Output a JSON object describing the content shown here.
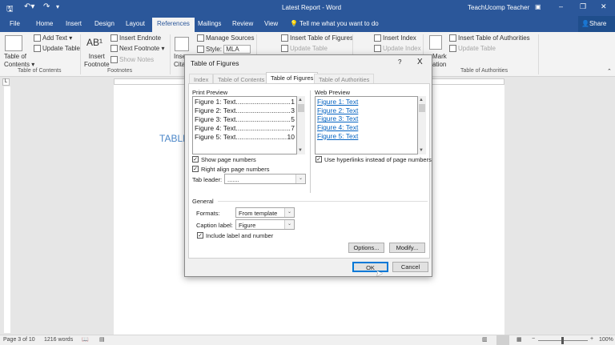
{
  "window": {
    "title": "Latest Report - Word",
    "user": "TeachUcomp Teacher"
  },
  "qat": {
    "save": "save-icon",
    "undo": "undo-icon",
    "redo": "redo-icon"
  },
  "tabs": [
    "File",
    "Home",
    "Insert",
    "Design",
    "Layout",
    "References",
    "Mailings",
    "Review",
    "View"
  ],
  "active_tab": "References",
  "tell_me": "Tell me what you want to do",
  "share": "Share",
  "ribbon": {
    "toc": {
      "btn1": "Table of",
      "btn2": "Contents",
      "add_text": "Add Text",
      "update_table": "Update Table",
      "group": "Table of Contents"
    },
    "footnotes": {
      "insert1": "Insert",
      "insert2": "Footnote",
      "insert_endnote": "Insert Endnote",
      "next_footnote": "Next Footnote",
      "show_notes": "Show Notes",
      "group": "Footnotes"
    },
    "citations": {
      "insert": "Inse",
      "citation": "Citati",
      "manage_sources": "Manage Sources",
      "style_label": "Style:",
      "style_value": "MLA"
    },
    "captions": {
      "insert_tof": "Insert Table of Figures",
      "update_table": "Update Table"
    },
    "index": {
      "insert_index": "Insert Index",
      "update_index": "Update Index"
    },
    "authorities": {
      "mark1": "Mark",
      "mark2": "ation",
      "insert_toa": "Insert Table of Authorities",
      "update_table": "Update Table",
      "group": "Table of Authorities"
    }
  },
  "document": {
    "heading": "TABLE"
  },
  "status": {
    "page": "Page 3 of 10",
    "words": "1216 words",
    "zoom": "100%",
    "zoom_level_percent": 100
  },
  "dialog": {
    "title": "Table of Figures",
    "help": "?",
    "close": "X",
    "tabs": [
      "Index",
      "Table of Contents",
      "Table of Figures",
      "Table of Authorities"
    ],
    "active_tab": "Table of Figures",
    "print_preview": {
      "label": "Print Preview",
      "entries": [
        {
          "text": "Figure 1: Text",
          "page": "1"
        },
        {
          "text": "Figure 2: Text",
          "page": "3"
        },
        {
          "text": "Figure 3: Text",
          "page": "5"
        },
        {
          "text": "Figure 4: Text",
          "page": "7"
        },
        {
          "text": "Figure 5: Text",
          "page": "10"
        }
      ]
    },
    "web_preview": {
      "label": "Web Preview",
      "entries": [
        "Figure 1: Text",
        "Figure 2: Text",
        "Figure 3: Text",
        "Figure 4: Text",
        "Figure 5: Text"
      ]
    },
    "show_page_numbers": {
      "label": "Show page numbers",
      "checked": true
    },
    "right_align": {
      "label": "Right align page numbers",
      "checked": true
    },
    "tab_leader": {
      "label": "Tab leader:",
      "value": "......."
    },
    "use_hyperlinks": {
      "label": "Use hyperlinks instead of page numbers",
      "checked": true
    },
    "general": {
      "label": "General",
      "formats_label": "Formats:",
      "formats_value": "From template",
      "caption_label": "Caption label:",
      "caption_value": "Figure",
      "include": {
        "label": "Include label and number",
        "checked": true
      }
    },
    "options": "Options...",
    "modify": "Modify...",
    "ok": "OK",
    "cancel": "Cancel"
  }
}
